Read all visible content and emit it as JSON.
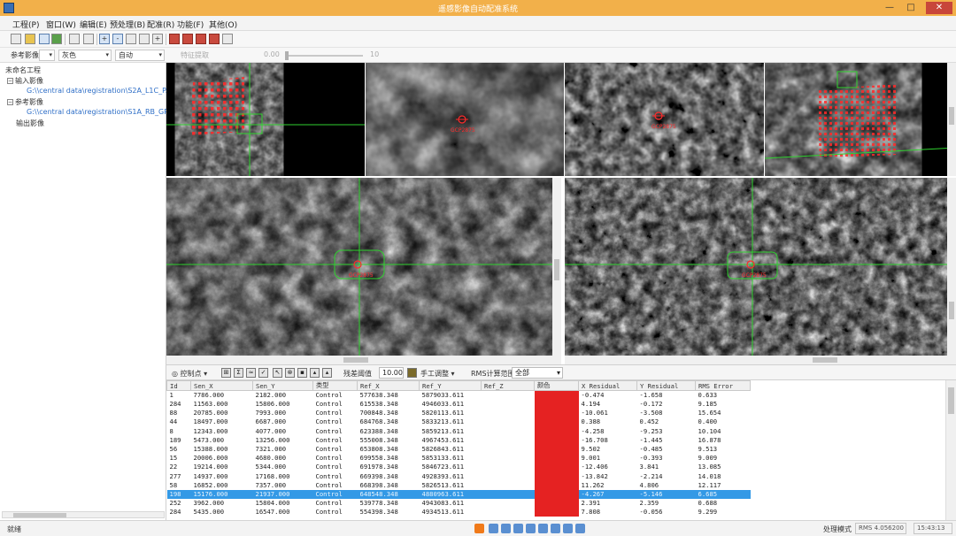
{
  "window": {
    "title": "遥感影像自动配准系统",
    "min": "—",
    "max": "□",
    "close": "✕"
  },
  "menu": [
    "工程(P)",
    "窗口(W)",
    "编辑(E)",
    "预处理(B)",
    "配准(R)",
    "功能(F)",
    "其他(O)"
  ],
  "toolbar2": {
    "ref_label": "参考影像",
    "band_label": "灰色",
    "stretch_value": "自动",
    "feature_label": "特征提取",
    "slider_value": "0.00",
    "slider_max": "10"
  },
  "tree": {
    "root": "未命名工程",
    "input_label": "输入影像",
    "input_path": "G:\\\\central data\\registration\\S2A_L1C_P...",
    "ref_label": "参考影像",
    "ref_path": "G:\\\\central data\\registration\\S1A_RB_GR...",
    "output_label": "输出影像"
  },
  "overview": {
    "point_label": "GCP2875"
  },
  "gcp_toolbar": {
    "control_label": "控制点",
    "threshold_label": "残差阈值",
    "threshold_value": "10.00",
    "manual_label": "手工调整",
    "rms_label": "RMS计算范围",
    "rms_value": "全部"
  },
  "table": {
    "headers": [
      "Id",
      "Sen_X",
      "Sen_Y",
      "类型",
      "Ref_X",
      "Ref_Y",
      "Ref_Z",
      "颜色",
      "X Residual",
      "Y Residual",
      "RMS Error"
    ],
    "rows": [
      [
        "1",
        "7786.000",
        "2182.000",
        "Control",
        "577638.348",
        "5879033.611",
        "",
        "",
        "-0.474",
        "-1.658",
        "0.633"
      ],
      [
        "284",
        "11563.000",
        "15806.000",
        "Control",
        "615538.348",
        "4946033.611",
        "",
        "",
        "4.194",
        "-0.172",
        "9.185"
      ],
      [
        "88",
        "20785.000",
        "7993.000",
        "Control",
        "700848.348",
        "5820113.611",
        "",
        "",
        "-10.061",
        "-3.508",
        "15.654"
      ],
      [
        "44",
        "18497.000",
        "6687.000",
        "Control",
        "684768.348",
        "5833213.611",
        "",
        "",
        "0.388",
        "0.452",
        "0.400"
      ],
      [
        "8",
        "12343.000",
        "4077.000",
        "Control",
        "623388.348",
        "5859213.611",
        "",
        "",
        "-4.258",
        "-9.253",
        "10.104"
      ],
      [
        "189",
        "5473.000",
        "13256.000",
        "Control",
        "555008.348",
        "4967453.611",
        "",
        "",
        "-16.708",
        "-1.445",
        "16.878"
      ],
      [
        "56",
        "15388.000",
        "7321.000",
        "Control",
        "653808.348",
        "5826843.611",
        "",
        "",
        "9.502",
        "-0.485",
        "9.513"
      ],
      [
        "15",
        "20006.000",
        "4680.000",
        "Control",
        "699558.348",
        "5853133.611",
        "",
        "",
        "9.001",
        "-0.393",
        "9.009"
      ],
      [
        "22",
        "19214.000",
        "5344.000",
        "Control",
        "691978.348",
        "5846723.611",
        "",
        "",
        "-12.406",
        "3.841",
        "13.085"
      ],
      [
        "277",
        "14937.000",
        "17168.000",
        "Control",
        "669398.348",
        "4928393.611",
        "",
        "",
        "-13.842",
        "-2.214",
        "14.018"
      ],
      [
        "58",
        "16852.000",
        "7357.000",
        "Control",
        "668398.348",
        "5826513.611",
        "",
        "",
        "11.262",
        "4.806",
        "12.117"
      ],
      [
        "198",
        "15176.000",
        "21937.000",
        "Control",
        "648548.348",
        "4880963.611",
        "",
        "",
        "-4.267",
        "-5.146",
        "6.685"
      ],
      [
        "252",
        "3962.000",
        "15804.000",
        "Control",
        "539778.348",
        "4943083.611",
        "",
        "",
        "2.391",
        "2.359",
        "0.688"
      ],
      [
        "284",
        "5435.000",
        "16547.000",
        "Control",
        "554398.348",
        "4934513.611",
        "",
        "",
        "7.808",
        "-0.056",
        "9.299"
      ]
    ],
    "selected_row": 11
  },
  "status": {
    "left": "就绪",
    "mode": "处理模式",
    "rms": "RMS 4.056200",
    "time": "15:43:13"
  },
  "colors": {
    "accent": "#3399e6",
    "gcp": "#e52222",
    "title": "#f2b04a",
    "crosshair": "#2fd12f"
  }
}
